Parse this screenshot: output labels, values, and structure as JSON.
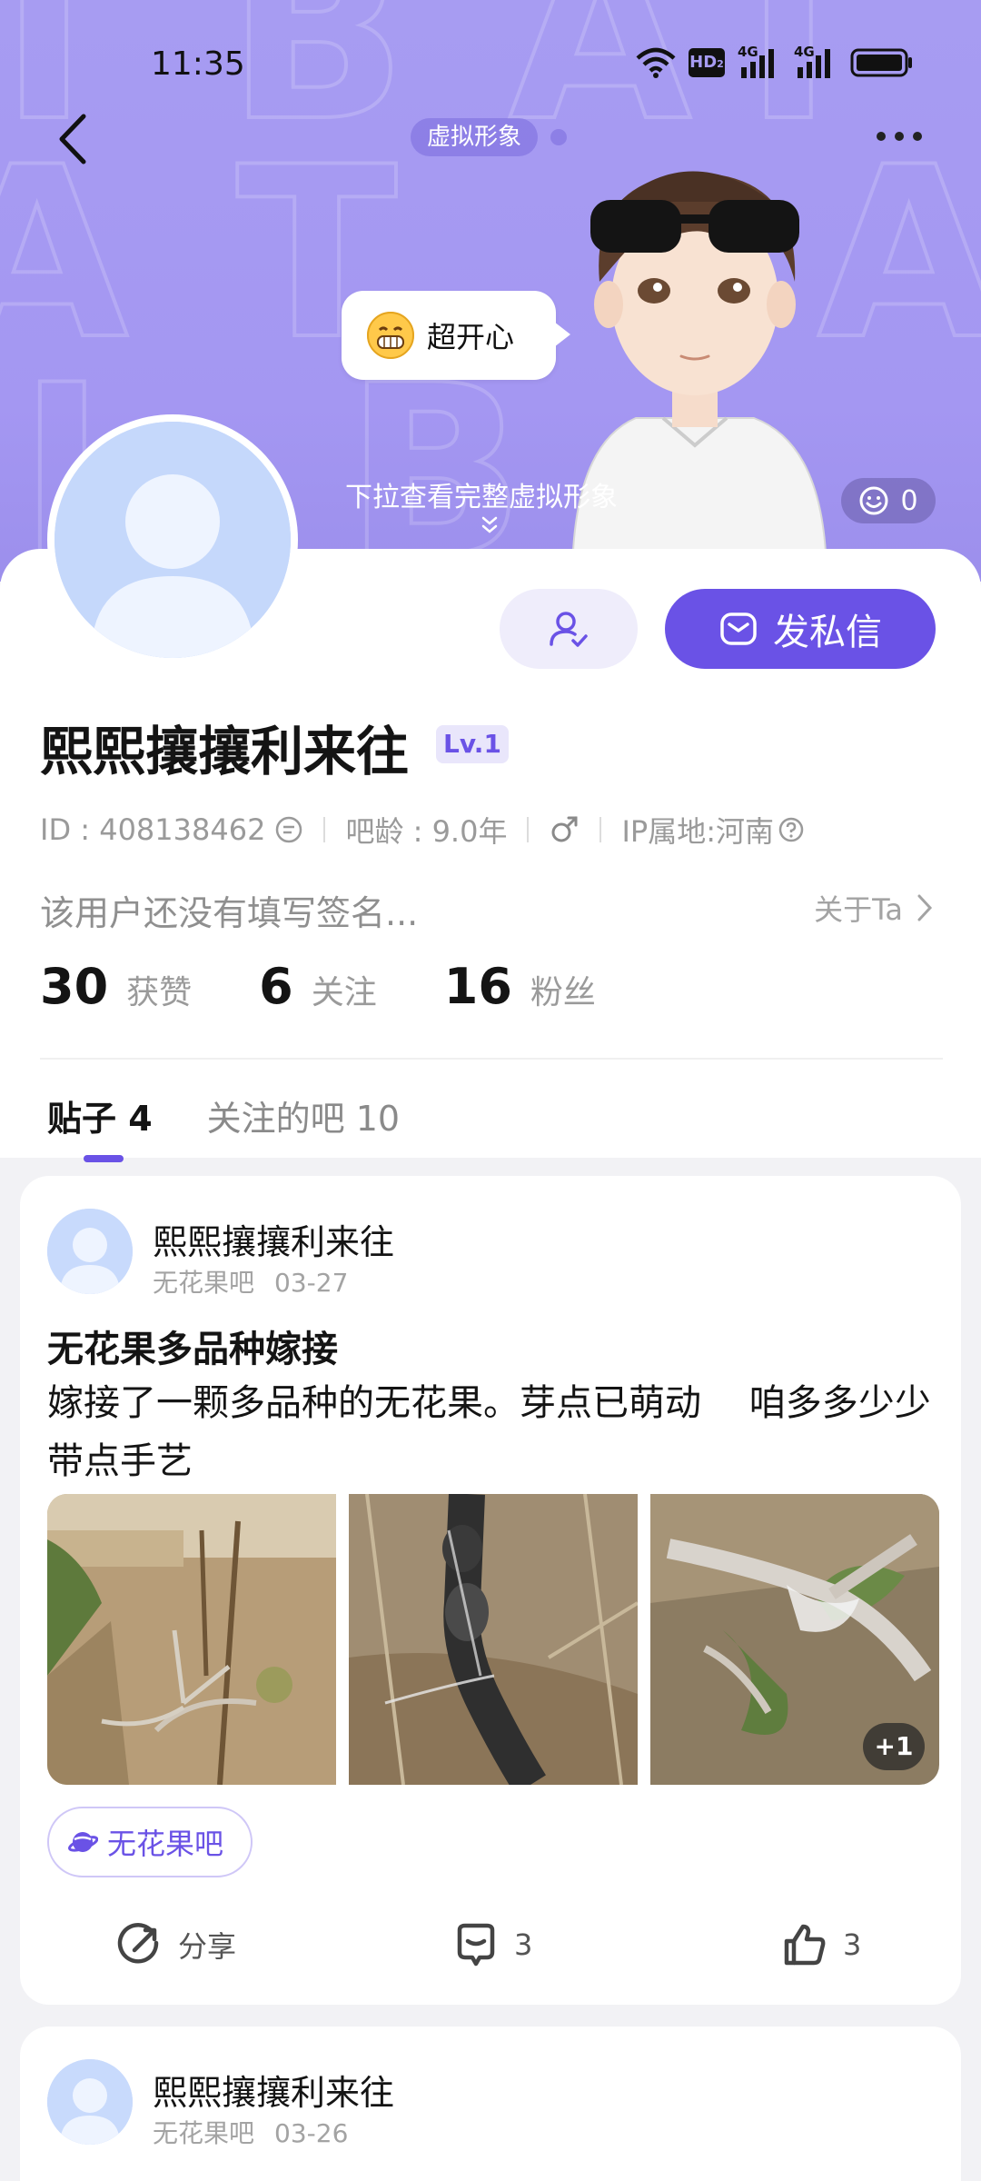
{
  "status_bar": {
    "time": "11:35",
    "hd_label": "HD",
    "hd_sub": "2",
    "net1": "4G",
    "net2": "4G"
  },
  "header": {
    "virtual_avatar_chip": "虚拟形象",
    "bubble_text": "超开心",
    "pull_hint": "下拉查看完整虚拟形象",
    "like_count": "0"
  },
  "profile": {
    "name": "熙熙攘攘利来往",
    "level": "Lv.1",
    "id_text": "ID : 408138462",
    "age_text": "吧龄 : 9.0年",
    "ip_text": "IP属地:河南",
    "signature": "该用户还没有填写签名...",
    "about_label": "关于Ta",
    "dm_button": "发私信",
    "stats": [
      {
        "num": "30",
        "label": "获赞"
      },
      {
        "num": "6",
        "label": "关注"
      },
      {
        "num": "16",
        "label": "粉丝"
      }
    ]
  },
  "tabs": [
    {
      "label": "贴子 4"
    },
    {
      "label": "关注的吧 10"
    }
  ],
  "posts": [
    {
      "author": "熙熙攘攘利来往",
      "forum": "无花果吧",
      "date": "03-27",
      "title": "无花果多品种嫁接",
      "body": "嫁接了一颗多品种的无花果。芽点已萌动 　咱多多少少带点手艺",
      "more_images": "+1",
      "tag": "无花果吧",
      "share_label": "分享",
      "comments": "3",
      "likes": "3"
    },
    {
      "author": "熙熙攘攘利来往",
      "forum": "无花果吧",
      "date": "03-26"
    }
  ],
  "colors": {
    "banner": "#a79cf2",
    "accent": "#6a52e6",
    "page_bg": "#f2f2f5"
  }
}
